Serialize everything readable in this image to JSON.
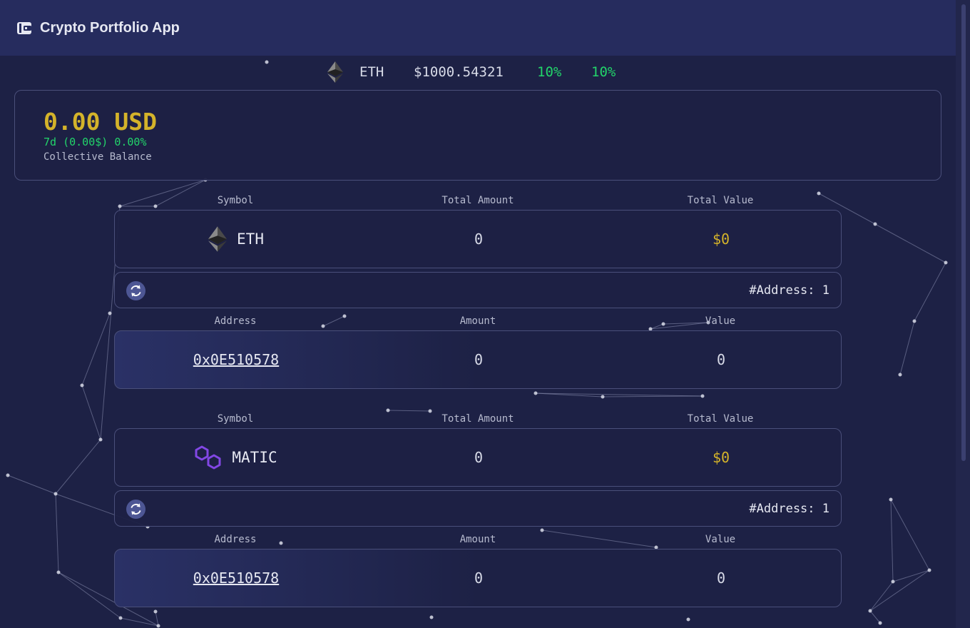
{
  "app": {
    "title": "Crypto Portfolio App",
    "icon": "wallet-icon"
  },
  "ticker": {
    "icon": "eth-icon",
    "symbol": "ETH",
    "price": "$1000.54321",
    "change_a": "10%",
    "change_b": "10%"
  },
  "balance": {
    "amount": "0.00 USD",
    "period": "7d",
    "change_abs": "(0.00$)",
    "change_pct": "0.00%",
    "label": "Collective Balance"
  },
  "headers": {
    "symbol": "Symbol",
    "total_amount": "Total Amount",
    "total_value": "Total Value",
    "address": "Address",
    "amount": "Amount",
    "value": "Value"
  },
  "assets": [
    {
      "icon": "eth-icon",
      "symbol": "ETH",
      "total_amount": "0",
      "total_value": "$0",
      "address_count": "#Address: 1",
      "addresses": [
        {
          "address": "0x0E510578",
          "amount": "0",
          "value": "0"
        }
      ]
    },
    {
      "icon": "matic-icon",
      "symbol": "MATIC",
      "total_amount": "0",
      "total_value": "$0",
      "address_count": "#Address: 1",
      "addresses": [
        {
          "address": "0x0E510578",
          "amount": "0",
          "value": "0"
        }
      ]
    }
  ],
  "colors": {
    "background": "#1d2145",
    "header": "#262c5e",
    "gold": "#d4b32a",
    "green": "#22d46a",
    "matic": "#8247e5"
  }
}
